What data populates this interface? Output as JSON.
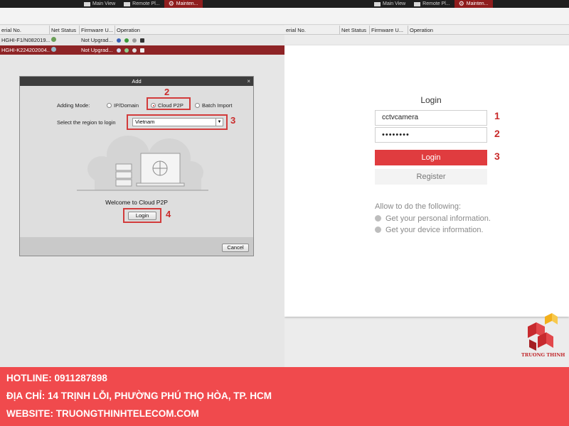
{
  "left": {
    "tabs": [
      "Main View",
      "Remote Pl...",
      "Mainten..."
    ],
    "columns": [
      "erial No.",
      "Net Status",
      "Firmware U...",
      "Operation"
    ],
    "rows": [
      {
        "serial": "HGHI-F1/N082019...",
        "firmware": "Not Upgrad..."
      },
      {
        "serial": "HGHI-K224202004...",
        "firmware": "Not Upgrad..."
      }
    ],
    "dialog": {
      "title": "Add",
      "close": "×",
      "adding_mode_label": "Adding Mode:",
      "mode_options": [
        "IP/Domain",
        "Cloud P2P",
        "Batch Import"
      ],
      "selected_mode": "Cloud P2P",
      "region_label": "Select the region to login",
      "region_value": "Vietnam",
      "welcome": "Welcome to Cloud P2P",
      "login_label": "Login",
      "cancel_label": "Cancel",
      "steps": [
        "2",
        "3",
        "4"
      ]
    }
  },
  "right": {
    "tabs": [
      "Main View",
      "Remote Pl...",
      "Mainten..."
    ],
    "columns": [
      "erial No.",
      "Net Status",
      "Firmware U...",
      "Operation"
    ],
    "login": {
      "title": "Login",
      "username": "cctvcamera",
      "password": "••••••••",
      "login_label": "Login",
      "register_label": "Register",
      "allow_text": "Allow to do the following:",
      "permissions": [
        "Get your personal information.",
        "Get your device information."
      ],
      "steps": [
        "1",
        "2",
        "3"
      ]
    }
  },
  "brand": {
    "logo_text": "TRUONG THINH",
    "colors": {
      "red": "#e03c3f",
      "banner": "#f04a4d",
      "accent_yellow": "#f3b01c"
    }
  },
  "footer": {
    "hotline": "HOTLINE: 0911287898",
    "address": "ĐỊA CHỈ: 14 TRỊNH LỖI, PHƯỜNG PHÚ THỌ HÒA, TP. HCM",
    "website": "WEBSITE: TRUONGTHINHTELECOM.COM"
  }
}
